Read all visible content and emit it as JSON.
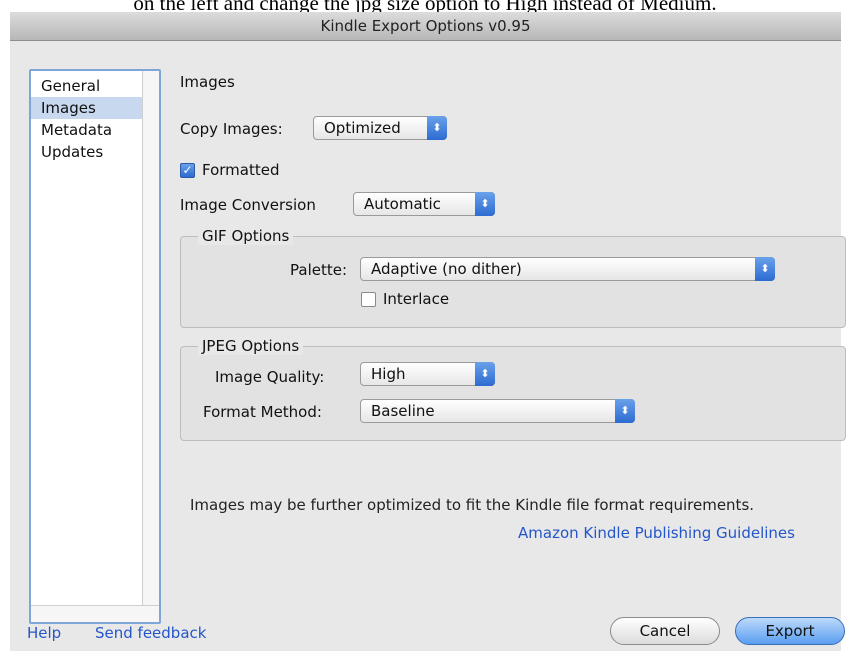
{
  "caption": "on the left and change the jpg size option to High instead of Medium.",
  "window": {
    "title": "Kindle Export Options v0.95"
  },
  "sidebar": {
    "items": [
      "General",
      "Images",
      "Metadata",
      "Updates"
    ],
    "selected": "Images"
  },
  "images": {
    "section_title": "Images",
    "copy_images_label": "Copy Images:",
    "copy_images_value": "Optimized",
    "formatted_label": "Formatted",
    "formatted_checked": true,
    "image_conversion_label": "Image Conversion",
    "image_conversion_value": "Automatic"
  },
  "gif": {
    "title": "GIF Options",
    "palette_label": "Palette:",
    "palette_value": "Adaptive (no dither)",
    "interlace_label": "Interlace",
    "interlace_checked": false
  },
  "jpeg": {
    "title": "JPEG Options",
    "quality_label": "Image Quality:",
    "quality_value": "High",
    "format_label": "Format Method:",
    "format_value": "Baseline"
  },
  "note": {
    "text": "Images may be further optimized to fit the Kindle file format requirements.",
    "link": "Amazon Kindle Publishing Guidelines"
  },
  "footer": {
    "help": "Help",
    "feedback": "Send feedback",
    "cancel": "Cancel",
    "export": "Export"
  },
  "colors": {
    "accent": "#2c6bd2",
    "link": "#2456c9"
  }
}
